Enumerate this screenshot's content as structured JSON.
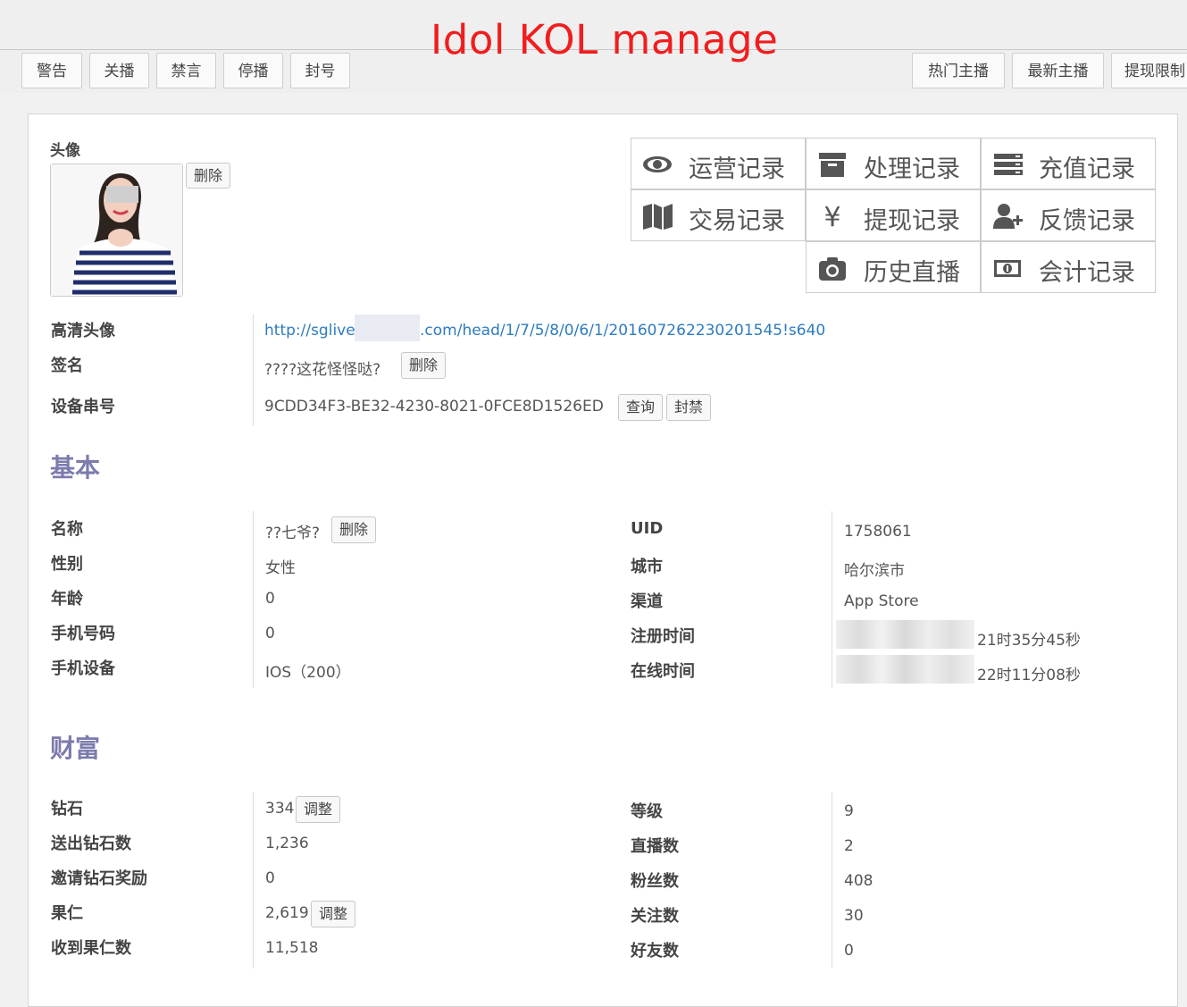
{
  "overlay_title": "Idol KOL manage",
  "toolbar": {
    "left": [
      "警告",
      "关播",
      "禁言",
      "停播",
      "封号"
    ],
    "right": [
      "热门主播",
      "最新主播",
      "提现限制"
    ]
  },
  "profile": {
    "avatar_label": "头像",
    "delete_label": "删除",
    "hd_avatar_label": "高清头像",
    "hd_avatar_url_start": "http://sglive",
    "hd_avatar_url_end": ".com/head/1/7/5/8/0/6/1/20160726223020​1545!s640",
    "signature_label": "签名",
    "signature_value": "????这花怪怪哒?",
    "device_label": "设备串号",
    "device_value": "9CDD34F3-BE32-4230-8021-0FCE8D1526ED",
    "query_label": "查询",
    "ban_label": "封禁"
  },
  "records": [
    {
      "icon": "eye-icon",
      "label": "运营记录"
    },
    {
      "icon": "archive-icon",
      "label": "处理记录"
    },
    {
      "icon": "list-icon",
      "label": "充值记录"
    },
    {
      "icon": "map-icon",
      "label": "交易记录"
    },
    {
      "icon": "yen-icon",
      "label": "提现记录"
    },
    {
      "icon": "user-add-icon",
      "label": "反馈记录"
    },
    {
      "icon": "camera-icon",
      "label": "历史直播"
    },
    {
      "icon": "money-icon",
      "label": "会计记录"
    }
  ],
  "basic": {
    "title": "基本",
    "left": [
      {
        "label": "名称",
        "value": "??七爷?",
        "button": "删除"
      },
      {
        "label": "性别",
        "value": "女性"
      },
      {
        "label": "年龄",
        "value": "0"
      },
      {
        "label": "手机号码",
        "value": "0"
      },
      {
        "label": "手机设备",
        "value": "IOS（200）"
      }
    ],
    "right": [
      {
        "label": "UID",
        "value": "1758061"
      },
      {
        "label": "城市",
        "value": "哈尔滨市"
      },
      {
        "label": "渠道",
        "value": "App Store"
      },
      {
        "label": "注册时间",
        "value": "21时35分45秒"
      },
      {
        "label": "在线时间",
        "value": "22时11分08秒"
      }
    ]
  },
  "wealth": {
    "title": "财富",
    "left": [
      {
        "label": "钻石",
        "value": "334",
        "button": "调整"
      },
      {
        "label": "送出钻石数",
        "value": "1,236"
      },
      {
        "label": "邀请钻石奖励",
        "value": "0"
      },
      {
        "label": "果仁",
        "value": "2,619",
        "button": "调整"
      },
      {
        "label": "收到果仁数",
        "value": "11,518"
      }
    ],
    "right": [
      {
        "label": "等级",
        "value": "9"
      },
      {
        "label": "直播数",
        "value": "2"
      },
      {
        "label": "粉丝数",
        "value": "408"
      },
      {
        "label": "关注数",
        "value": "30"
      },
      {
        "label": "好友数",
        "value": "0"
      }
    ]
  }
}
